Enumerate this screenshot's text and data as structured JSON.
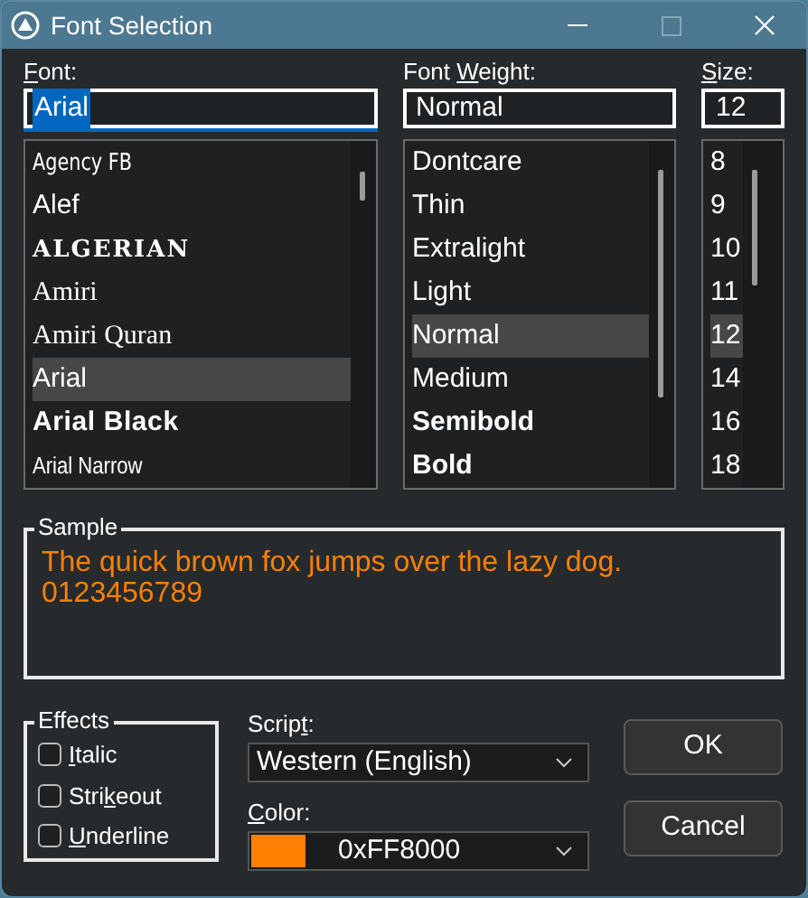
{
  "window": {
    "title": "Font Selection"
  },
  "font": {
    "label": {
      "key": "F",
      "after": "ont:"
    },
    "value": "Arial",
    "text_selected": true,
    "items": [
      {
        "name": "Agency FB",
        "kind": "condensed",
        "selected": false
      },
      {
        "name": "Alef",
        "kind": "sans",
        "selected": false
      },
      {
        "name": "ALGERIAN",
        "kind": "caps",
        "selected": false
      },
      {
        "name": "Amiri",
        "kind": "serif",
        "selected": false
      },
      {
        "name": "Amiri Quran",
        "kind": "serif",
        "selected": false
      },
      {
        "name": "Arial",
        "kind": "sans",
        "selected": true
      },
      {
        "name": "Arial Black",
        "kind": "heavy",
        "selected": false
      },
      {
        "name": "Arial Narrow",
        "kind": "narrow",
        "selected": false
      }
    ]
  },
  "weight": {
    "label": {
      "before": "Font ",
      "key": "W",
      "after": "eight:"
    },
    "value": "Normal",
    "items": [
      {
        "name": "Dontcare",
        "kind": "plain",
        "selected": false
      },
      {
        "name": "Thin",
        "kind": "plain",
        "selected": false
      },
      {
        "name": "Extralight",
        "kind": "plain",
        "selected": false
      },
      {
        "name": "Light",
        "kind": "plain",
        "selected": false
      },
      {
        "name": "Normal",
        "kind": "plain",
        "selected": true
      },
      {
        "name": "Medium",
        "kind": "plain",
        "selected": false
      },
      {
        "name": "Semibold",
        "kind": "bold",
        "selected": false
      },
      {
        "name": "Bold",
        "kind": "bold",
        "selected": false
      }
    ]
  },
  "size": {
    "label": {
      "key": "S",
      "after": "ize:"
    },
    "value": "12",
    "items": [
      {
        "name": "8",
        "selected": false
      },
      {
        "name": "9",
        "selected": false
      },
      {
        "name": "10",
        "selected": false
      },
      {
        "name": "11",
        "selected": false
      },
      {
        "name": "12",
        "selected": true
      },
      {
        "name": "14",
        "selected": false
      },
      {
        "name": "16",
        "selected": false
      },
      {
        "name": "18",
        "selected": false
      }
    ]
  },
  "sample": {
    "title": "Sample",
    "lines": [
      "The quick brown fox jumps over the lazy dog.",
      "0123456789"
    ],
    "color": "#ff8000"
  },
  "effects": {
    "title": "Effects",
    "options": [
      {
        "label": {
          "key": "I",
          "after": "talic"
        },
        "checked": false
      },
      {
        "label": {
          "before": "Stri",
          "key": "k",
          "after": "eout"
        },
        "checked": false
      },
      {
        "label": {
          "key": "U",
          "after": "nderline"
        },
        "checked": false
      }
    ]
  },
  "script": {
    "label": {
      "before": "Scrip",
      "key": "t",
      "after": ":"
    },
    "value": "Western (English)"
  },
  "color": {
    "label": {
      "key": "C",
      "after": "olor:"
    },
    "value": "0xFF8000",
    "color": "#ff8000"
  },
  "buttons": [
    "OK",
    "Cancel"
  ]
}
